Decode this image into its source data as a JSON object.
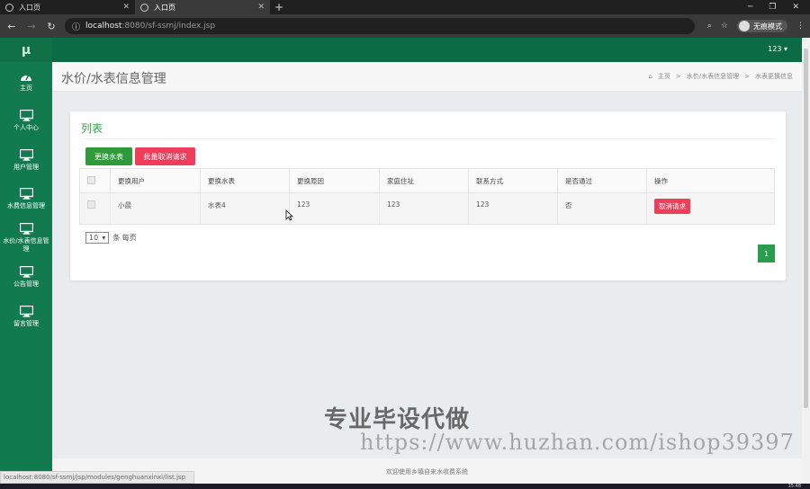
{
  "browser": {
    "tabs": [
      {
        "title": "入口页",
        "active": false
      },
      {
        "title": "入口页",
        "active": true
      }
    ],
    "new_tab": "+",
    "url_host": "localhost",
    "url_rest": ":8080/sf-ssmj/index.jsp",
    "profile_label": "无痕模式",
    "window_controls": {
      "minimize": "─",
      "restore": "❐",
      "close": "✕"
    }
  },
  "app": {
    "user": "123 ▾",
    "logo": "μ",
    "sidebar": [
      {
        "label": "主页",
        "icon": "dashboard-icon"
      },
      {
        "label": "个人中心",
        "icon": "monitor-icon"
      },
      {
        "label": "用户管理",
        "icon": "monitor-icon"
      },
      {
        "label": "水费信息管理",
        "icon": "monitor-icon"
      },
      {
        "label": "水价/水表信息管理",
        "icon": "monitor-icon"
      },
      {
        "label": "公告管理",
        "icon": "monitor-icon"
      },
      {
        "label": "留言管理",
        "icon": "monitor-icon"
      }
    ],
    "page_title": "水价/水表信息管理",
    "breadcrumb": {
      "home": "主页",
      "sep": ">",
      "level1": "水价/水表信息管理",
      "level2": "水表更换信息"
    },
    "panel": {
      "title": "列表",
      "swap_button": "更换水表",
      "batch_cancel_button": "批量取消请求"
    },
    "table": {
      "headers": [
        "更换用户",
        "更换水表",
        "更换原因",
        "家庭住址",
        "联系方式",
        "是否通过",
        "操作"
      ],
      "rows": [
        {
          "user": "小晨",
          "meter": "水表4",
          "reason": "123",
          "address": "123",
          "phone": "123",
          "approved": "否",
          "action": "取消请求"
        }
      ]
    },
    "pager": {
      "page_size": "10",
      "per_page_label": "条 每页",
      "current_page": "1"
    },
    "footer": "欢迎使用乡镇自来水收费系统",
    "status_url": "localhost:8080/sf-ssmj/jsp/modules/genghuanxinxi/list.jsp",
    "watermark": "专业毕设代做",
    "watermark_url": "https://www.huzhan.com/ishop39397",
    "clock": "15:48"
  },
  "colors": {
    "nav": "#0b6b45",
    "sidebar": "#117a4e",
    "primary_green": "#2e9b3b",
    "danger_red": "#ee3e5a"
  }
}
